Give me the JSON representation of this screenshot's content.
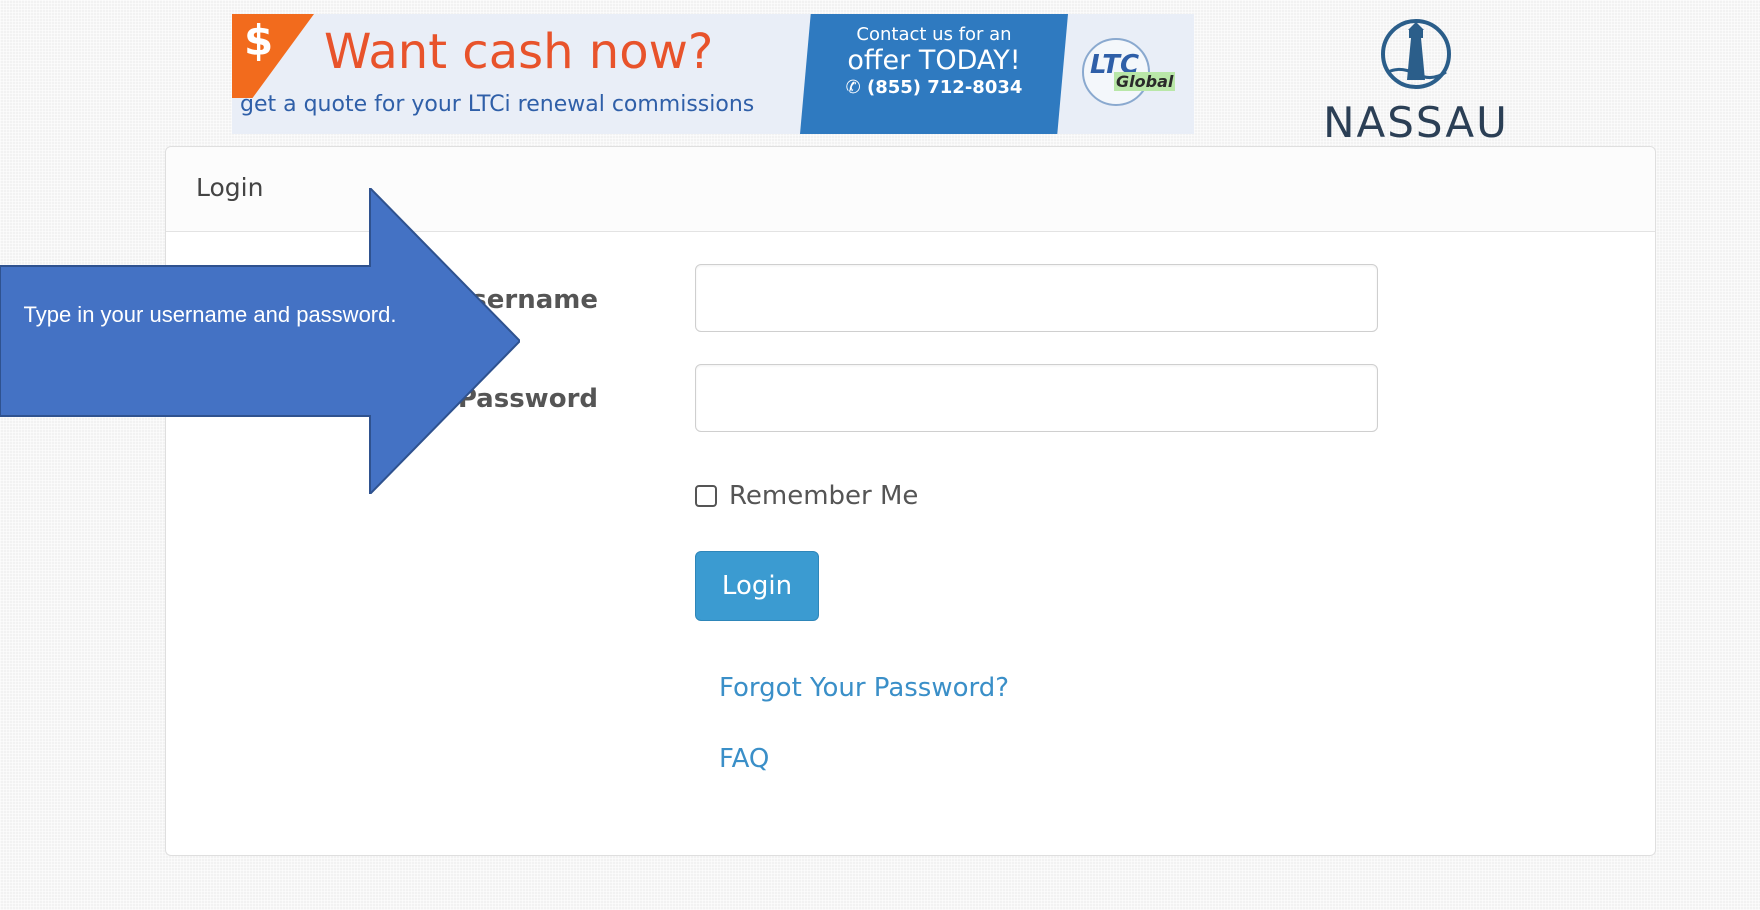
{
  "banner": {
    "dollar": "$",
    "headline": "Want cash now?",
    "subline": "get a quote for your LTCi renewal commissions",
    "contact_line1": "Contact us for an",
    "contact_line2": "offer TODAY!",
    "phone": "(855) 712-8034",
    "logo_ltc": "LTC",
    "logo_global": "Global",
    "phone_icon": "phone-icon"
  },
  "brand": {
    "name": "NASSAU",
    "logo_icon": "lighthouse-icon"
  },
  "panel": {
    "title": "Login"
  },
  "form": {
    "username_label": "Username",
    "username_value": "",
    "password_label": "Password",
    "password_value": "",
    "remember_label": "Remember Me",
    "remember_checked": false,
    "login_button": "Login",
    "forgot_link": "Forgot Your Password?",
    "faq_link": "FAQ"
  },
  "callout": {
    "text": "Type in your username and password."
  },
  "colors": {
    "button": "#3b9bd1",
    "link": "#3a8fc8",
    "arrow": "#4472c4",
    "banner_orange": "#e8532b",
    "banner_blue": "#2f7ac0"
  }
}
